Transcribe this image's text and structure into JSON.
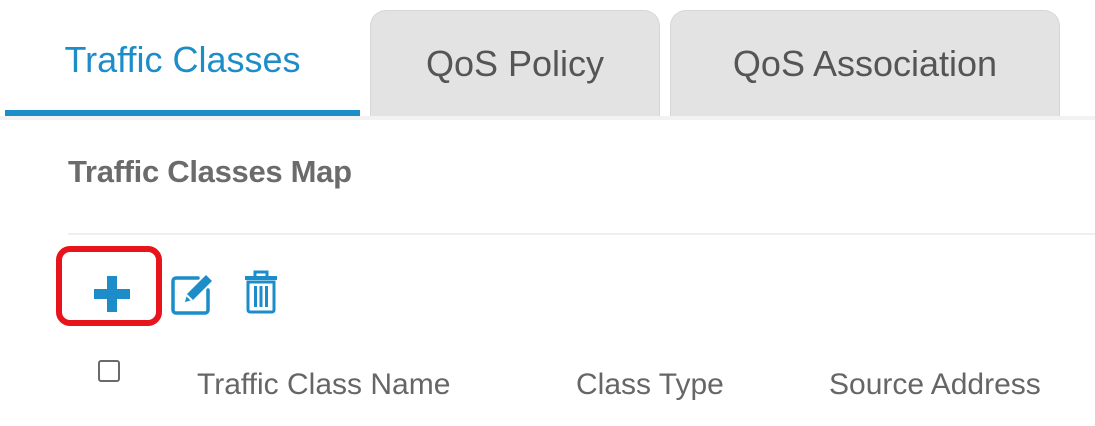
{
  "tabs": [
    {
      "label": "Traffic Classes",
      "active": true
    },
    {
      "label": "QoS Policy",
      "active": false
    },
    {
      "label": "QoS Association",
      "active": false
    }
  ],
  "section": {
    "title": "Traffic Classes Map"
  },
  "toolbar": {
    "icons": [
      "plus-icon",
      "edit-icon",
      "trash-icon"
    ],
    "highlighted": "plus-icon"
  },
  "table": {
    "columns": [
      "Traffic Class Name",
      "Class Type",
      "Source Address"
    ],
    "select_all_checked": false
  },
  "colors": {
    "accent": "#1c8dc8",
    "highlight": "#e8141c",
    "tab_inactive_bg": "#e3e3e3",
    "text": "#666666"
  }
}
